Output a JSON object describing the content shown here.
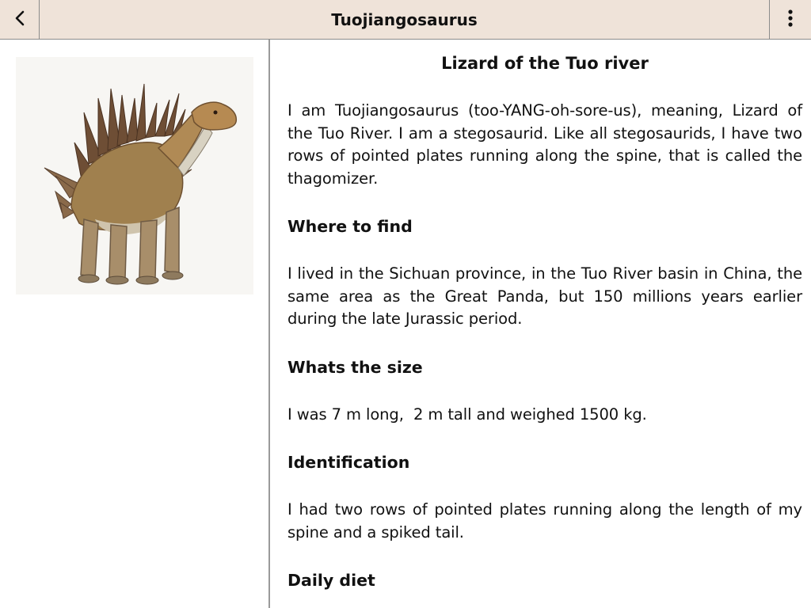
{
  "header": {
    "title": "Tuojiangosaurus",
    "back_icon": "chevron-left-icon",
    "menu_icon": "vertical-ellipsis-icon"
  },
  "image": {
    "subject": "Tuojiangosaurus dinosaur illustration"
  },
  "article": {
    "heading": "Lizard of the Tuo river",
    "intro": "I am Tuojiangosaurus (too-YANG-oh-sore-us), meaning, Lizard of the Tuo River. I am a stegosaurid. Like all stegosaurids, I have two rows of pointed plates running along the spine, that is called the thagomizer.",
    "sections": [
      {
        "title": "Where to find",
        "text": "I lived in the Sichuan province, in the Tuo River basin in China, the same area as the Great Panda, but 150 millions years earlier during the late Jurassic period."
      },
      {
        "title": "Whats the size",
        "text": "I was 7 m long,  2 m tall and weighed 1500 kg."
      },
      {
        "title": "Identification",
        "text": "I had two rows of pointed plates running along the length of my spine and a spiked tail."
      },
      {
        "title": "Daily diet",
        "text": ""
      }
    ]
  },
  "colors": {
    "header_bg": "#efe3d9",
    "divider": "#9a9a9a"
  }
}
